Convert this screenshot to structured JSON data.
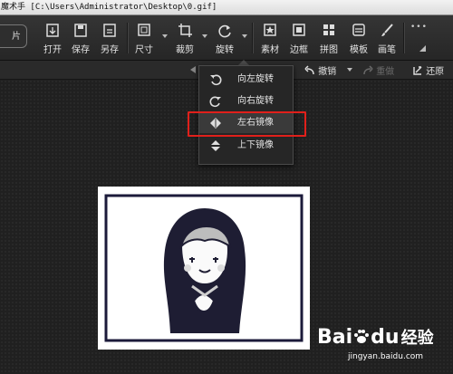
{
  "title_bar": {
    "text": "魔术手 [C:\\Users\\Administrator\\Desktop\\0.gif]"
  },
  "toolbar": {
    "picture_button_label": "片",
    "tools": [
      {
        "label": "打开",
        "icon": "open-icon"
      },
      {
        "label": "保存",
        "icon": "save-icon"
      },
      {
        "label": "另存",
        "icon": "save-as-icon"
      },
      {
        "label": "尺寸",
        "icon": "resize-icon"
      },
      {
        "label": "裁剪",
        "icon": "crop-icon"
      },
      {
        "label": "旋转",
        "icon": "rotate-icon"
      },
      {
        "label": "素材",
        "icon": "material-icon"
      },
      {
        "label": "边框",
        "icon": "border-icon"
      },
      {
        "label": "拼图",
        "icon": "collage-icon"
      },
      {
        "label": "模板",
        "icon": "template-icon"
      },
      {
        "label": "画笔",
        "icon": "brush-icon"
      }
    ],
    "more_label": "•••"
  },
  "subbar": {
    "undo_label": "撤销",
    "redo_label": "重做",
    "restore_label": "还原"
  },
  "rotate_menu": {
    "items": [
      {
        "label": "向左旋转",
        "icon": "rotate-left-icon"
      },
      {
        "label": "向右旋转",
        "icon": "rotate-right-icon"
      },
      {
        "label": "左右镜像",
        "icon": "mirror-horizontal-icon"
      },
      {
        "label": "上下镜像",
        "icon": "mirror-vertical-icon"
      }
    ],
    "highlighted_item": "左右镜像"
  },
  "colors": {
    "highlight": "#e0201b",
    "toolbar_bg": "#2f2f2f",
    "canvas_bg": "#202020"
  },
  "watermark": {
    "logo_bai": "Bai",
    "logo_du": "du",
    "logo_jingyan": "经验",
    "url": "jingyan.baidu.com"
  }
}
